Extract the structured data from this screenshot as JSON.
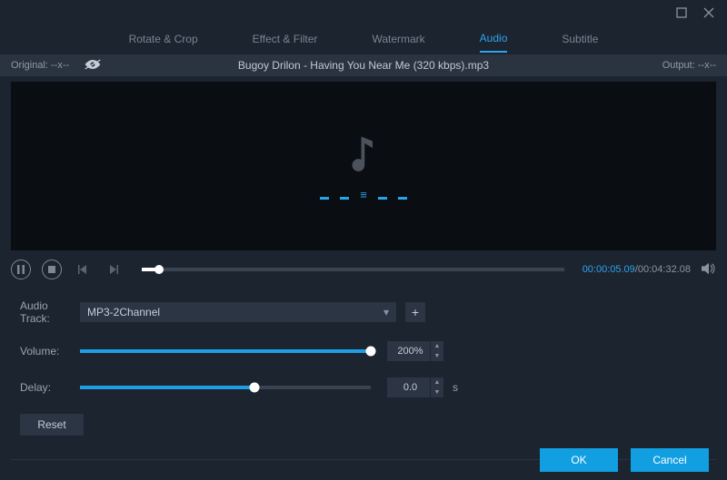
{
  "window": {},
  "tabs": {
    "rotate": "Rotate & Crop",
    "effect": "Effect & Filter",
    "watermark": "Watermark",
    "audio": "Audio",
    "subtitle": "Subtitle",
    "active": "audio"
  },
  "header": {
    "original_label": "Original:  --x--",
    "output_label": "Output:  --x--",
    "filename": "Bugoy Drilon - Having You Near Me (320 kbps).mp3"
  },
  "transport": {
    "current_time": "00:00:05.09",
    "total_time": "00:04:32.08",
    "seek_pct": 4
  },
  "controls": {
    "audio_track": {
      "label": "Audio Track:",
      "value": "MP3-2Channel"
    },
    "volume": {
      "label": "Volume:",
      "value": "200%",
      "pct": 100
    },
    "delay": {
      "label": "Delay:",
      "value": "0.0",
      "unit": "s",
      "pct": 60
    },
    "reset": "Reset"
  },
  "footer": {
    "ok": "OK",
    "cancel": "Cancel"
  }
}
